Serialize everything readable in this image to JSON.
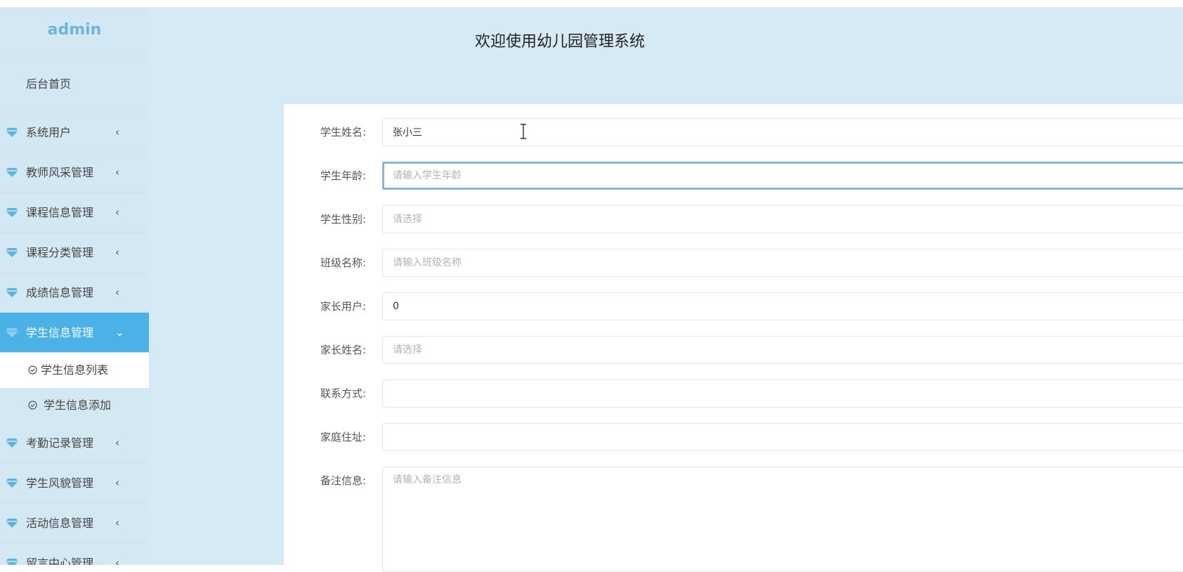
{
  "sidebar": {
    "brand": "admin",
    "home": "后台首页",
    "menu": [
      {
        "label": "系统用户"
      },
      {
        "label": "教师风采管理"
      },
      {
        "label": "课程信息管理"
      },
      {
        "label": "课程分类管理"
      },
      {
        "label": "成绩信息管理"
      },
      {
        "label": "学生信息管理",
        "active": true,
        "children": [
          {
            "label": "学生信息列表",
            "current": true
          },
          {
            "label": "学生信息添加"
          }
        ]
      },
      {
        "label": "考勤记录管理"
      },
      {
        "label": "学生风貌管理"
      },
      {
        "label": "活动信息管理"
      },
      {
        "label": "留言中心管理"
      }
    ],
    "icon": "gem-icon",
    "accent": "#4ab2e6"
  },
  "header": {
    "title": "欢迎使用幼儿园管理系统"
  },
  "form": {
    "student_name": {
      "label": "学生姓名:",
      "value": "张小三"
    },
    "student_age": {
      "label": "学生年龄:",
      "placeholder": "请输入学生年龄"
    },
    "student_gender": {
      "label": "学生性别:",
      "placeholder": "请选择"
    },
    "class_name": {
      "label": "班级名称:",
      "placeholder": "请输入班级名称"
    },
    "parent_user": {
      "label": "家长用户:",
      "value": "0"
    },
    "parent_name": {
      "label": "家长姓名:",
      "placeholder": "请选择"
    },
    "contact": {
      "label": "联系方式:",
      "value": ""
    },
    "address": {
      "label": "家庭住址:",
      "value": ""
    },
    "remarks": {
      "label": "备注信息:",
      "placeholder": "请输入备注信息"
    }
  }
}
